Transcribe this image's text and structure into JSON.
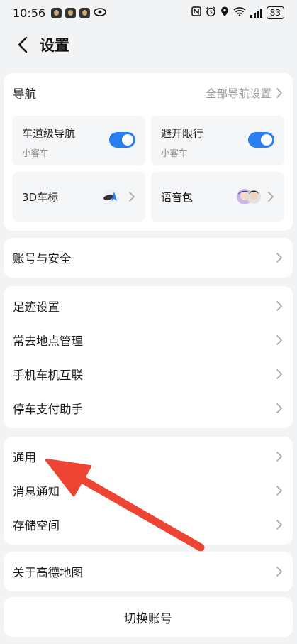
{
  "status_bar": {
    "time": "10:56",
    "battery": "83",
    "icons": [
      "nfc-icon",
      "alarm-icon",
      "location-icon",
      "wifi-icon",
      "signal-icon",
      "battery-icon",
      "eye-icon"
    ]
  },
  "header": {
    "title": "设置",
    "back_icon": "chevron-left-icon"
  },
  "nav_card": {
    "title": "导航",
    "all_settings_label": "全部导航设置",
    "tiles": {
      "lane_nav": {
        "title": "车道级导航",
        "sub": "小客车",
        "enabled": true
      },
      "avoid_limit": {
        "title": "避开限行",
        "sub": "小客车",
        "enabled": true
      },
      "car_icon": {
        "title": "3D车标"
      },
      "voice_pack": {
        "title": "语音包"
      }
    }
  },
  "account_card": {
    "items": [
      "账号与安全"
    ]
  },
  "tools_card": {
    "items": [
      "足迹设置",
      "常去地点管理",
      "手机车机互联",
      "停车支付助手"
    ]
  },
  "general_card": {
    "items": [
      "通用",
      "消息通知",
      "存储空间"
    ]
  },
  "about_card": {
    "items": [
      "关于高德地图"
    ]
  },
  "switch_account": {
    "label": "切换账号"
  },
  "colors": {
    "accent": "#2a7ff0",
    "annotation_arrow": "#ee4433",
    "background": "#f2f3f5"
  }
}
